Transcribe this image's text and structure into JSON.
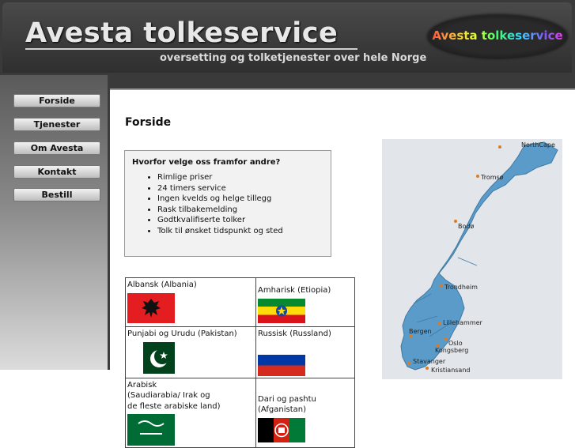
{
  "header": {
    "title": "Avesta tolkeservice",
    "tagline": "oversetting og tolketjenester over hele Norge",
    "logo_text": "Avesta tolkeservice"
  },
  "nav": [
    {
      "label": "Forside"
    },
    {
      "label": "Tjenester"
    },
    {
      "label": "Om Avesta"
    },
    {
      "label": "Kontakt"
    },
    {
      "label": "Bestill"
    }
  ],
  "main": {
    "page_title": "Forside",
    "why": {
      "title": "Hvorfor velge oss framfor andre?",
      "items": [
        "Rimlige priser",
        "24 timers service",
        "Ingen kvelds og helge tillegg",
        "Rask tilbakemelding",
        "Godtkvalifiserte tolker",
        "Tolk til ønsket tidspunkt og sted"
      ]
    },
    "languages": [
      {
        "name": "Albansk (Albania)",
        "flag": "albania-flag"
      },
      {
        "name": "Amharisk (Etiopia)",
        "flag": "ethiopia-flag"
      },
      {
        "name": "Punjabi og Urudu (Pakistan)",
        "flag": "pakistan-flag"
      },
      {
        "name": "Russisk (Russland)",
        "flag": "russia-flag"
      },
      {
        "name_lines": [
          "Arabisk",
          "(Saudiarabia/ Irak og",
          "de fleste arabiske land)"
        ],
        "flag": "saudi-arabia-flag"
      },
      {
        "name": "Dari og pashtu (Afganistan)",
        "flag": "afghanistan-flag"
      }
    ]
  },
  "map": {
    "cities": [
      "NorthCape",
      "Tromsø",
      "Bodø",
      "Trondheim",
      "Lillehammer",
      "Bergen",
      "Oslo",
      "Kongsberg",
      "Stavanger",
      "Kristiansand"
    ]
  },
  "colors": {
    "header_bg": "#3a3a3a",
    "map_land": "#5b9bc9",
    "city_marker": "#e07a1f"
  }
}
